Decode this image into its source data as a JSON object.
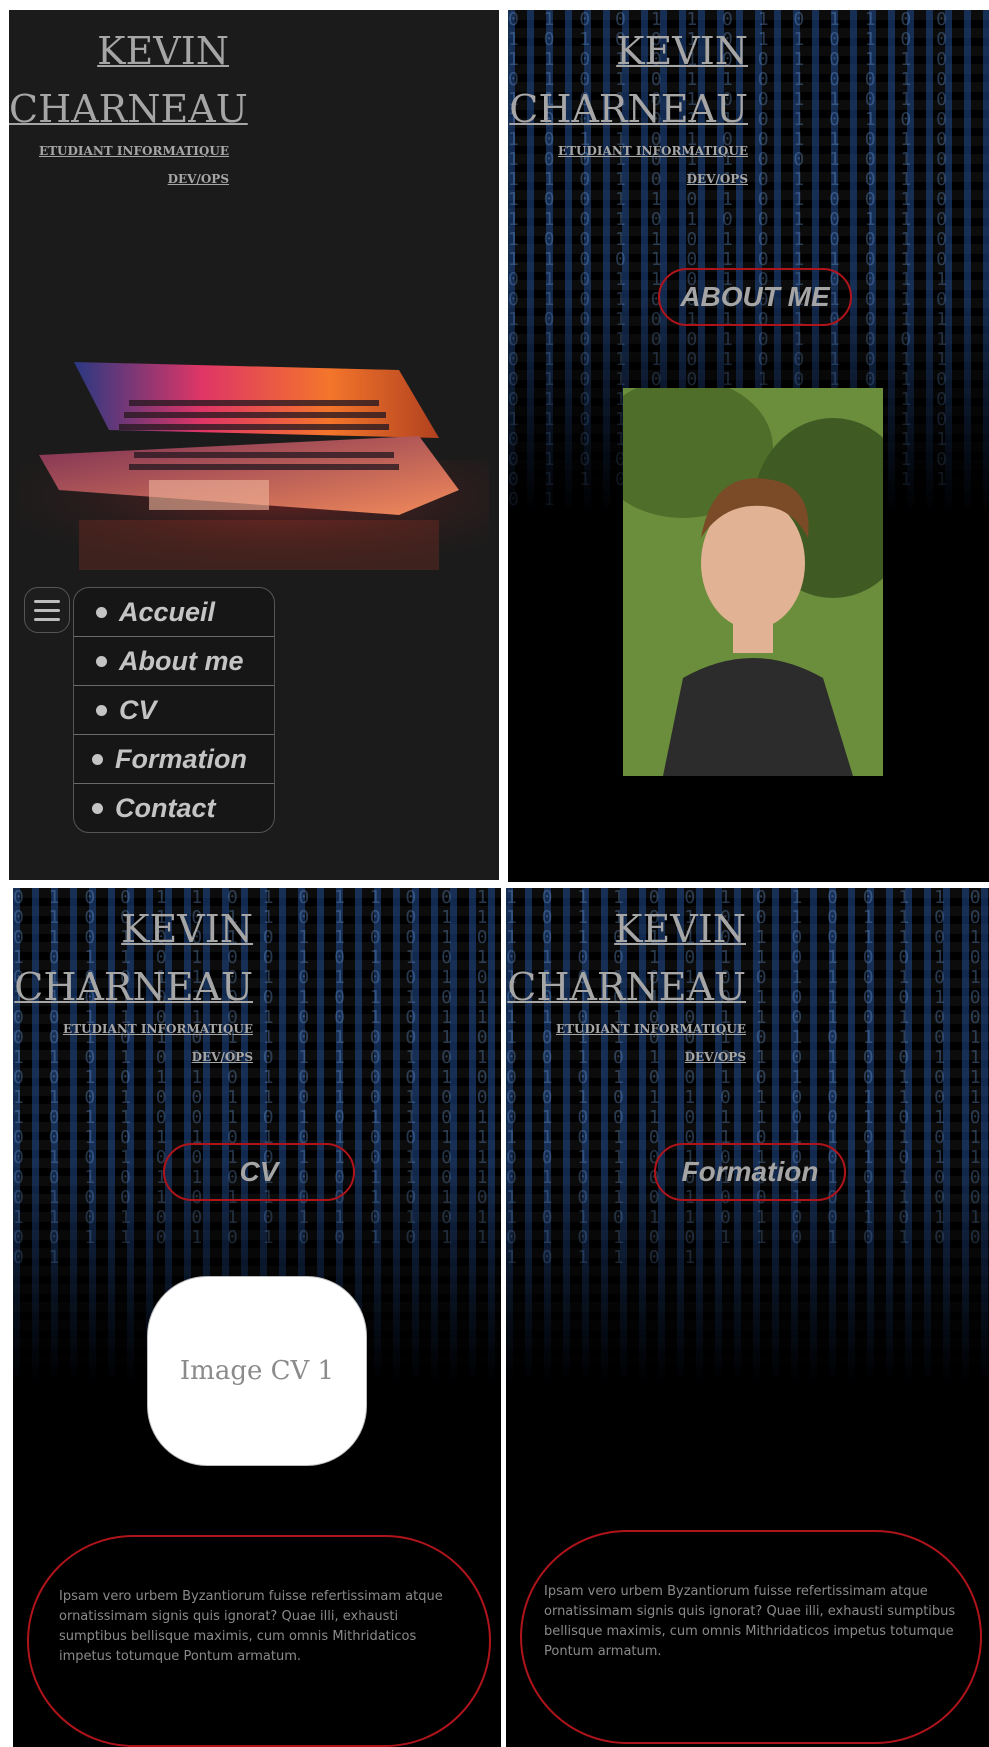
{
  "header": {
    "name_line1": "KEVIN",
    "name_line2": "CHARNEAU",
    "subtitle": "ETUDIANT INFORMATIQUE",
    "subtitle2": "DEV/OPS"
  },
  "nav": {
    "menu_icon": "hamburger-icon",
    "items": [
      {
        "label": "Accueil"
      },
      {
        "label": "About me"
      },
      {
        "label": "CV"
      },
      {
        "label": "Formation"
      },
      {
        "label": "Contact"
      }
    ]
  },
  "sections": {
    "about_title": "ABOUT ME",
    "cv_title": "CV",
    "cv_image_label": "Image CV 1",
    "formation_title": "Formation"
  },
  "content": {
    "lorem": "Ipsam vero urbem Byzantiorum fuisse refertissimam atque ornatissimam signis quis ignorat? Quae illi, exhausti sumptibus bellisque maximis, cum omnis Mithridaticos impetus totumque Pontum armatum."
  },
  "colors": {
    "accent_red": "#b0141b",
    "text_gray": "#a6a6a6",
    "matrix_blue": "#2f6fc0"
  }
}
